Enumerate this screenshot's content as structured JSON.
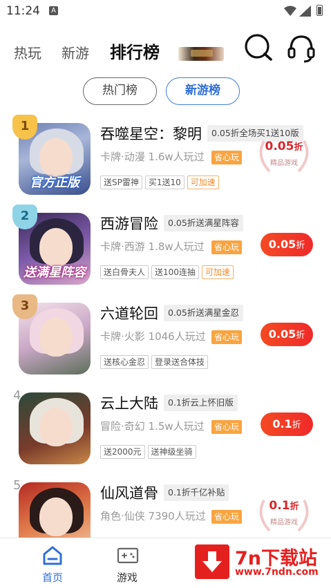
{
  "status_bar": {
    "time": "11:24",
    "notif_letter": "A"
  },
  "top_nav": {
    "tabs": [
      "热玩",
      "新游",
      "排行榜"
    ]
  },
  "segments": [
    "热门榜",
    "新游榜"
  ],
  "games": [
    {
      "rank": "1",
      "name": "吞噬星空：黎明",
      "promo": "0.05折全场买1送10版",
      "meta": "卡牌·动漫  1.6w人玩过",
      "save": "省心玩",
      "tags": [
        "送SP雷神",
        "买1送10",
        "可加速"
      ],
      "discount_value": "0.05",
      "discount_unit": "折",
      "discount_sub": "精品游戏",
      "icon_caption": "官方正版"
    },
    {
      "rank": "2",
      "name": "西游冒险",
      "promo": "0.05折送满星阵容",
      "meta": "卡牌·西游  1.8w人玩过",
      "save": "省心玩",
      "tags": [
        "送白骨夫人",
        "送100连抽",
        "可加速"
      ],
      "discount_value": "0.05",
      "discount_unit": "折",
      "icon_caption": "送满星阵容"
    },
    {
      "rank": "3",
      "name": "六道轮回",
      "promo": "0.05折送满星金忍",
      "meta": "卡牌·火影  1046人玩过",
      "save": "省心玩",
      "tags": [
        "送核心金忍",
        "登录送合体技"
      ],
      "discount_value": "0.05",
      "discount_unit": "折"
    },
    {
      "rank": "4",
      "name": "云上大陆",
      "promo": "0.1折云上怀旧版",
      "meta": "冒险·奇幻  1.5w人玩过",
      "save": "省心玩",
      "tags": [
        "送2000元",
        "送神级坐骑"
      ],
      "discount_value": "0.1",
      "discount_unit": "折"
    },
    {
      "rank": "5",
      "name": "仙风道骨",
      "promo": "0.1折千亿补贴",
      "meta": "角色·仙侠  7390人玩过",
      "save": "省心玩",
      "tags": [],
      "discount_value": "0.1",
      "discount_unit": "折",
      "discount_sub": "精品游戏"
    }
  ],
  "bottom_nav": {
    "home": "首页",
    "games": "游戏"
  },
  "watermark": {
    "title": "7n下载站",
    "url": "www.7ndn.com"
  },
  "colors": {
    "accent_blue": "#2f6fd6",
    "discount_red": "#ef2a2a",
    "save_orange": "#f9a440"
  }
}
